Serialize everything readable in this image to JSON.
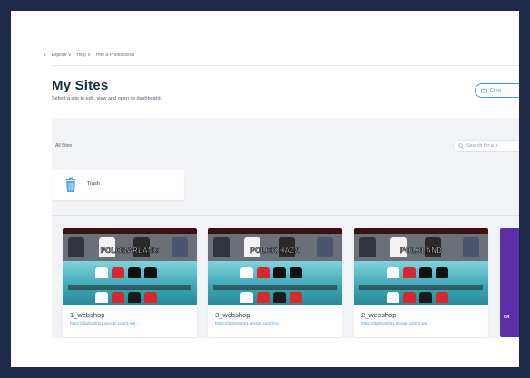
{
  "topnav": {
    "partial": "s",
    "items": [
      "Explore ∨",
      "Help ∨",
      "Hire a Professional"
    ]
  },
  "header": {
    "title": "My Sites",
    "subtitle": "Select a site to edit, view and open its dashboard.",
    "create_label": "Crea"
  },
  "toolbar": {
    "all_sites": "All Sites",
    "search_placeholder": "Search for a s"
  },
  "trash": {
    "label": "Trash"
  },
  "sites": [
    {
      "name": "1_webshop",
      "url": "https://digihot2021.wixsite.com/1-we...",
      "brand": "POLOBARLANG"
    },
    {
      "name": "3_webshop",
      "url": "https://digihot2021.wixsite.com/3-w...",
      "brand": "POLOK HAZA"
    },
    {
      "name": "2_webshop",
      "url": "https://digihot2021.wixsite.com/2-we...",
      "brand": "POLOLAND"
    }
  ],
  "promo": {
    "text": "CR"
  },
  "colors": {
    "accent": "#3899ec",
    "title": "#162d3d",
    "promo": "#5b2fa8",
    "frame": "#1d2a4a"
  }
}
